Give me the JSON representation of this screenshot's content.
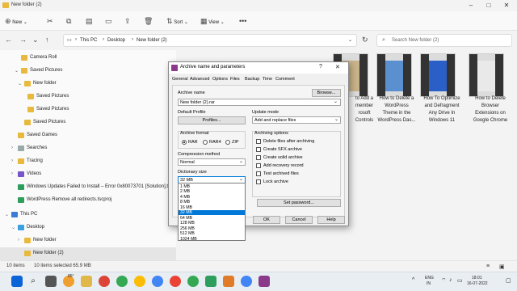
{
  "window": {
    "title": "New folder (2)"
  },
  "toolbar": {
    "new_label": "New",
    "sort_label": "Sort",
    "view_label": "View"
  },
  "address": {
    "path": [
      "This PC",
      "Desktop",
      "New folder (2)"
    ],
    "search_placeholder": "Search New folder (2)"
  },
  "sidebar": {
    "items": [
      {
        "label": "Camera Roll"
      },
      {
        "label": "Saved Pictures"
      },
      {
        "label": "New folder"
      },
      {
        "label": "Saved Pictures"
      },
      {
        "label": "Saved Pictures"
      },
      {
        "label": "Saved Pictures"
      },
      {
        "label": "Saved Games"
      },
      {
        "label": "Searches"
      },
      {
        "label": "Tracing"
      },
      {
        "label": "Videos"
      },
      {
        "label": "Windows Updates Failed to Install – Error 0x80073701 [Solution].tsproj"
      },
      {
        "label": "WordPress Remove all redirects.tscproj"
      },
      {
        "label": "This PC"
      },
      {
        "label": "Desktop"
      },
      {
        "label": "New folder"
      },
      {
        "label": "New folder (2)"
      }
    ]
  },
  "thumbnails": [
    {
      "caption": "to Add a\nmember\nrosoft\nControls"
    },
    {
      "caption": "How to Delete a\nWordPress\nTheme in the\nWordPress Das..."
    },
    {
      "caption": "How To Optimize\nand Defragment\nAny Drive In\nWindows 11"
    },
    {
      "caption": "How to Delete\nBrowser\nExtensions on\nGoogle Chrome"
    }
  ],
  "status": {
    "items": "10 items",
    "selected": "10 items selected  65.9 MB"
  },
  "dialog": {
    "title": "Archive name and parameters",
    "help": "?",
    "close": "✕",
    "tabs": [
      "General",
      "Advanced",
      "Options",
      "Files",
      "Backup",
      "Time",
      "Comment"
    ],
    "archive_name_label": "Archive name",
    "archive_name_value": "New folder (2).rar",
    "browse_label": "Browse...",
    "default_profile_label": "Default Profile",
    "profiles_label": "Profiles...",
    "update_mode_label": "Update mode",
    "update_mode_value": "Add and replace files",
    "archive_format_label": "Archive format",
    "formats": [
      "RAR",
      "RAR4",
      "ZIP"
    ],
    "selected_format": "RAR",
    "compression_method_label": "Compression method",
    "compression_method_value": "Normal",
    "dictionary_size_label": "Dictionary size",
    "dictionary_size_value": "32 MB",
    "archiving_options_label": "Archiving options",
    "archiving_options": [
      "Delete files after archiving",
      "Create SFX archive",
      "Create solid archive",
      "Add recovery record",
      "Test archived files",
      "Lock archive"
    ],
    "set_password_label": "Set password...",
    "ok_label": "OK",
    "cancel_label": "Cancel",
    "help_label": "Help",
    "dictionary_options": [
      "1 MB",
      "2 MB",
      "4 MB",
      "8 MB",
      "16 MB",
      "32 MB",
      "64 MB",
      "128 MB",
      "256 MB",
      "512 MB",
      "1024 MB"
    ],
    "dictionary_selected": "32 MB"
  },
  "taskbar": {
    "weather": "85°",
    "lang": "ENG",
    "region": "IN",
    "time": "18:01",
    "date": "16-07-2022"
  },
  "colors": {
    "accent": "#0078d7",
    "folder": "#e8b93d"
  }
}
